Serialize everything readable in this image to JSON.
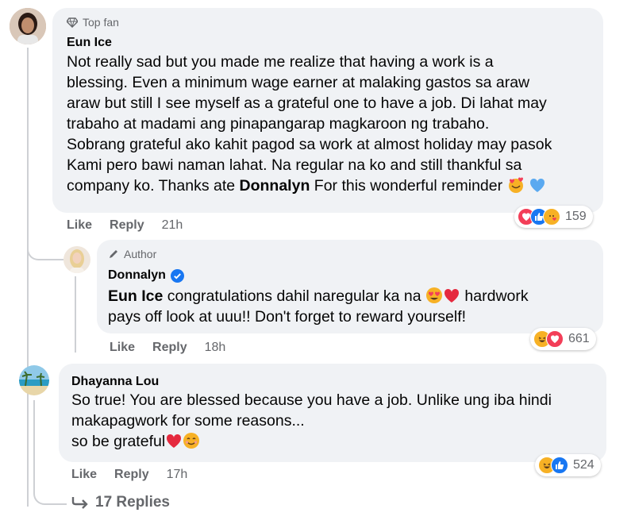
{
  "comments": [
    {
      "badge_label": "Top fan",
      "badge_icon": "diamond-icon",
      "author": "Eun Ice",
      "text_lines": [
        "Not really sad but you made me realize that having a work is a",
        "blessing. Even a minimum wage earner at malaking gastos sa araw",
        "araw but still I see myself as a grateful one to have a job. Di lahat may",
        "trabaho at madami ang pinapangarap magkaroon ng trabaho.",
        "Sobrang grateful ako kahit pagod sa work at almost holiday may pasok",
        "Kami pero bawi naman lahat. Na regular na ko and still thankful sa"
      ],
      "last_line_prefix": "company ko. Thanks ate ",
      "mention": "Donnalyn",
      "last_line_suffix": " For this wonderful reminder",
      "like_label": "Like",
      "reply_label": "Reply",
      "time": "21h",
      "reaction_count": "159",
      "reactions": [
        "love",
        "like",
        "care"
      ]
    },
    {
      "badge_label": "Author",
      "badge_icon": "pencil-icon",
      "author": "Donnalyn",
      "verified_icon": "verified-badge-icon",
      "mention": "Eun Ice",
      "line1_text": " congratulations dahil naregular ka na ",
      "line1_suffix": " hardwork",
      "line2": "pays off look at uuu!! Don't forget to reward yourself!",
      "like_label": "Like",
      "reply_label": "Reply",
      "time": "18h",
      "reaction_count": "661",
      "reactions": [
        "haha",
        "love"
      ]
    },
    {
      "author": "Dhayanna Lou",
      "line1": "So true! You are blessed because you have a job. Unlike ung iba hindi",
      "line2": "makapagwork for some reasons...",
      "line3": "so be grateful",
      "like_label": "Like",
      "reply_label": "Reply",
      "time": "17h",
      "reaction_count": "524",
      "reactions": [
        "haha",
        "like"
      ]
    }
  ],
  "replies_link": "17 Replies",
  "colors": {
    "bubble": "#f0f2f5",
    "secondary_text": "#65676b",
    "like_blue": "#1877f2",
    "love_red": "#f33e58",
    "haha_yellow": "#f7b125"
  }
}
